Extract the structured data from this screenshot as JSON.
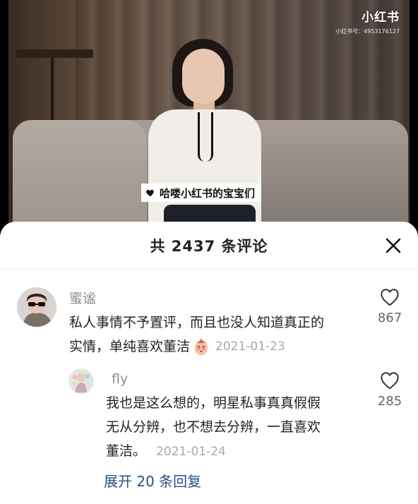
{
  "video": {
    "watermark_logo": "小红书",
    "watermark_id": "小红书号：4953176127",
    "subtitle": "哈喽小红书的宝宝们"
  },
  "sheet": {
    "title": "共 2437 条评论",
    "close_icon": "close-icon"
  },
  "comments": [
    {
      "username": "蜜谧",
      "line1": "私人事情不予置评，而且也没人知道真正的",
      "line2": "实情，单纯喜欢董洁",
      "date": "2021-01-23",
      "likes": "867",
      "emoji_icon": "shy-face-emoji-icon"
    }
  ],
  "reply": {
    "username": "fly",
    "line1": "我也是这么想的，明星私事真真假假",
    "line2": "无从分辨，也不想去分辨，一直喜欢",
    "line3": "董洁。",
    "date": "2021-01-24",
    "likes": "285"
  },
  "expand_label": "展开 20 条回复",
  "colors": {
    "link": "#2b4e88",
    "muted": "#8e8e8e",
    "text": "#222222"
  }
}
